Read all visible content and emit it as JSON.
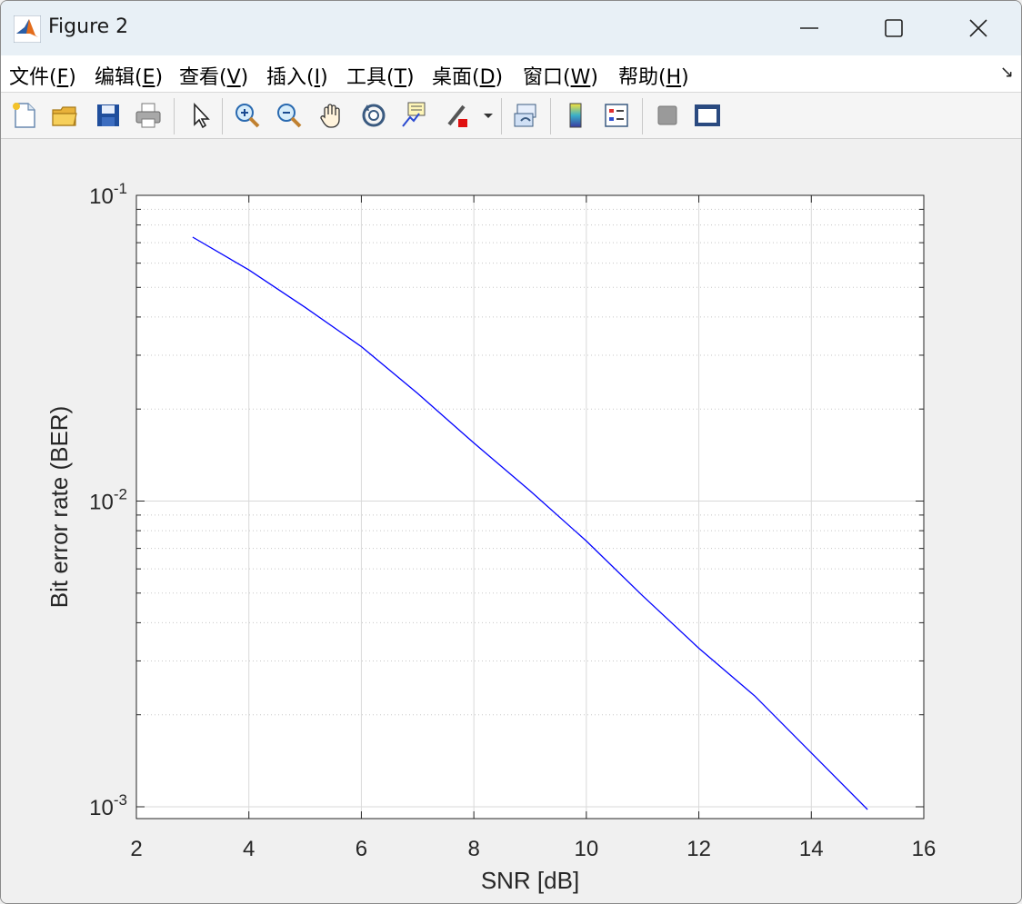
{
  "window": {
    "title": "Figure 2"
  },
  "menu": [
    {
      "text": "文件(",
      "key": "F",
      "end": ")"
    },
    {
      "text": "编辑(",
      "key": "E",
      "end": ")"
    },
    {
      "text": "查看(",
      "key": "V",
      "end": ")"
    },
    {
      "text": "插入(",
      "key": "I",
      "end": ")"
    },
    {
      "text": "工具(",
      "key": "T",
      "end": ")"
    },
    {
      "text": "桌面(",
      "key": "D",
      "end": ")"
    },
    {
      "text": "窗口(",
      "key": "W",
      "end": ")"
    },
    {
      "text": "帮助(",
      "key": "H",
      "end": ")"
    }
  ],
  "toolbar_icons": [
    "new-figure-icon",
    "open-file-icon",
    "save-icon",
    "print-icon",
    "select-arrow-icon",
    "zoom-in-icon",
    "zoom-out-icon",
    "pan-hand-icon",
    "rotate-3d-icon",
    "data-cursor-icon",
    "brush-icon",
    "link-plot-icon",
    "colorbar-icon",
    "legend-icon",
    "hide-plot-tools-icon",
    "show-plot-tools-icon"
  ],
  "colors": {
    "line": "#0000ff",
    "grid_major": "#d9d9d9",
    "grid_minor": "#c8c8c8",
    "axis": "#262626"
  },
  "chart_data": {
    "type": "line",
    "xlabel": "SNR [dB]",
    "ylabel": "Bit error rate (BER)",
    "xlim": [
      2,
      16
    ],
    "ylim": [
      0.0009,
      0.1
    ],
    "yscale": "log",
    "xticks": [
      "2",
      "4",
      "6",
      "8",
      "10",
      "12",
      "14",
      "16"
    ],
    "yticks": [
      {
        "base": "10",
        "exp": "-1"
      },
      {
        "base": "10",
        "exp": "-2"
      },
      {
        "base": "10",
        "exp": "-3"
      }
    ],
    "grid": true,
    "series": [
      {
        "x": [
          3,
          4,
          5,
          6,
          7,
          8,
          9,
          10,
          11,
          12,
          13,
          14,
          15
        ],
        "values": [
          0.073,
          0.057,
          0.043,
          0.032,
          0.0225,
          0.0155,
          0.0108,
          0.0074,
          0.0049,
          0.0033,
          0.0023,
          0.0015,
          0.00098
        ]
      }
    ]
  }
}
